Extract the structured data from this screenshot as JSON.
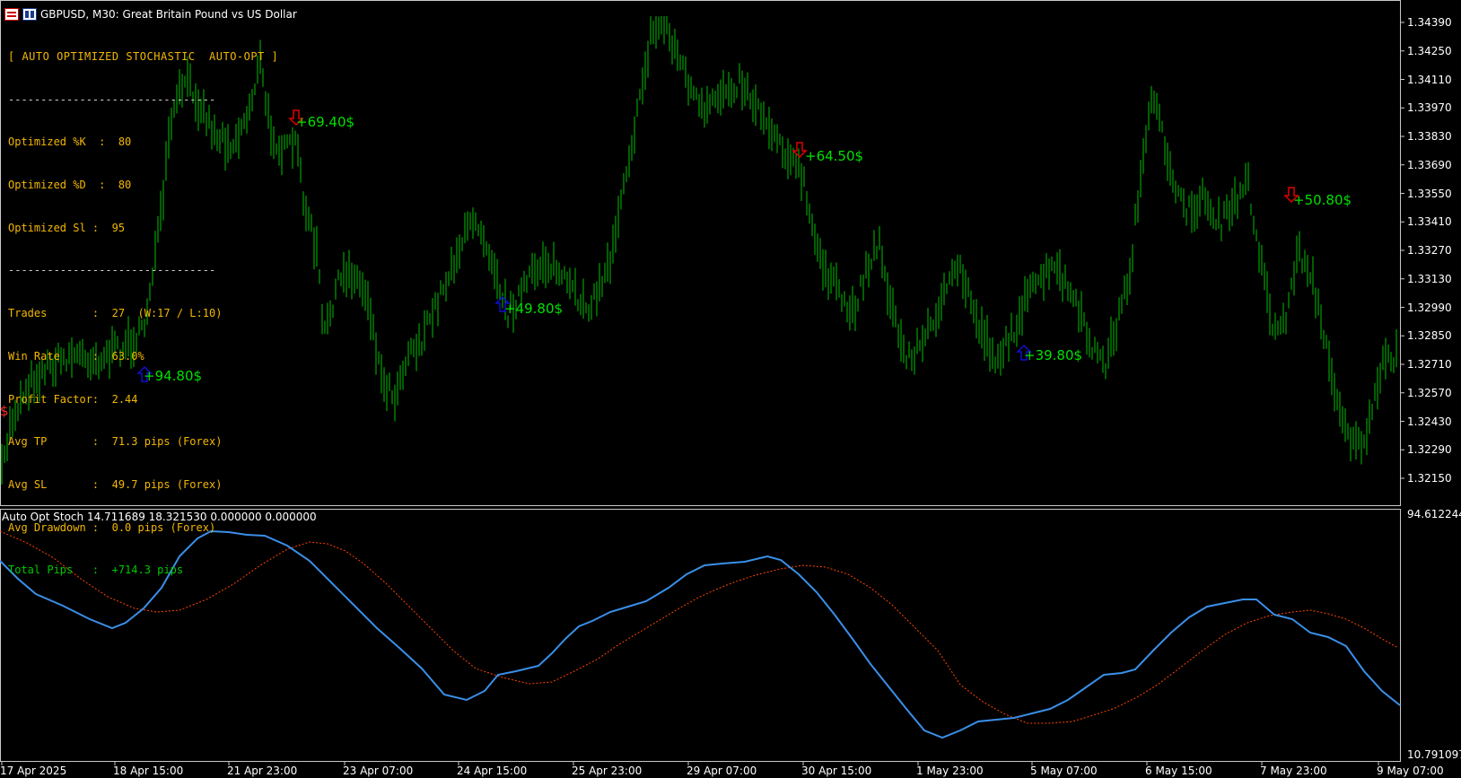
{
  "window": {
    "symbol_title": "GBPUSD, M30:  Great Britain Pound vs US Dollar",
    "icons": [
      "calendar-icon",
      "chart-window-icon"
    ]
  },
  "panel": {
    "title": "[ AUTO OPTIMIZED STOCHASTIC  AUTO-OPT ]",
    "separator": "--------------------------------",
    "opt_k": "Optimized %K  :  80",
    "opt_d": "Optimized %D  :  80",
    "opt_sl": "Optimized Sl :  95",
    "trades": "Trades       :  27  (W:17 / L:10)",
    "win_rate": "Win Rate     :  63.0%",
    "profit_factor": "Profit Factor:  2.44",
    "avg_tp": "Avg TP       :  71.3 pips (Forex)",
    "avg_sl": "Avg SL       :  49.7 pips (Forex)",
    "avg_drawdown": "Avg Drawdown :  0.0 pips (Forex)",
    "total_pips": "Total Pips   :  +714.3 pips"
  },
  "trade_labels": [
    {
      "text": "+94.80$",
      "signal": "buy"
    },
    {
      "text": "+69.40$",
      "signal": "sell"
    },
    {
      "text": "+49.80$",
      "signal": "buy"
    },
    {
      "text": "+64.50$",
      "signal": "sell"
    },
    {
      "text": "+39.80$",
      "signal": "buy"
    },
    {
      "text": "+50.80$",
      "signal": "sell"
    }
  ],
  "left_edge_label": "$",
  "price_axis": [
    "1.34390",
    "1.34250",
    "1.34110",
    "1.33970",
    "1.33830",
    "1.33690",
    "1.33550",
    "1.33410",
    "1.33270",
    "1.33130",
    "1.32990",
    "1.32850",
    "1.32710",
    "1.32570",
    "1.32430",
    "1.32290",
    "1.32150"
  ],
  "indicator": {
    "title": "Auto Opt Stoch 14.711689 18.321530 0.000000 0.000000",
    "scale_max": "94.612244",
    "scale_min": "10.791097"
  },
  "time_axis": [
    "17 Apr 2025",
    "18 Apr 15:00",
    "21 Apr 23:00",
    "23 Apr 07:00",
    "24 Apr 15:00",
    "25 Apr 23:00",
    "29 Apr 07:00",
    "30 Apr 15:00",
    "1 May 23:00",
    "5 May 07:00",
    "6 May 15:00",
    "7 May 23:00",
    "9 May 07:00"
  ],
  "colors": {
    "background": "#000000",
    "candles": "#00c000",
    "stoch_k": "#3a8fe8",
    "stoch_d": "#ff4500",
    "buy_arrow": "#1010d0",
    "sell_arrow": "#e00000",
    "panel_text": "#f2b705",
    "panel_green": "#00c800"
  }
}
